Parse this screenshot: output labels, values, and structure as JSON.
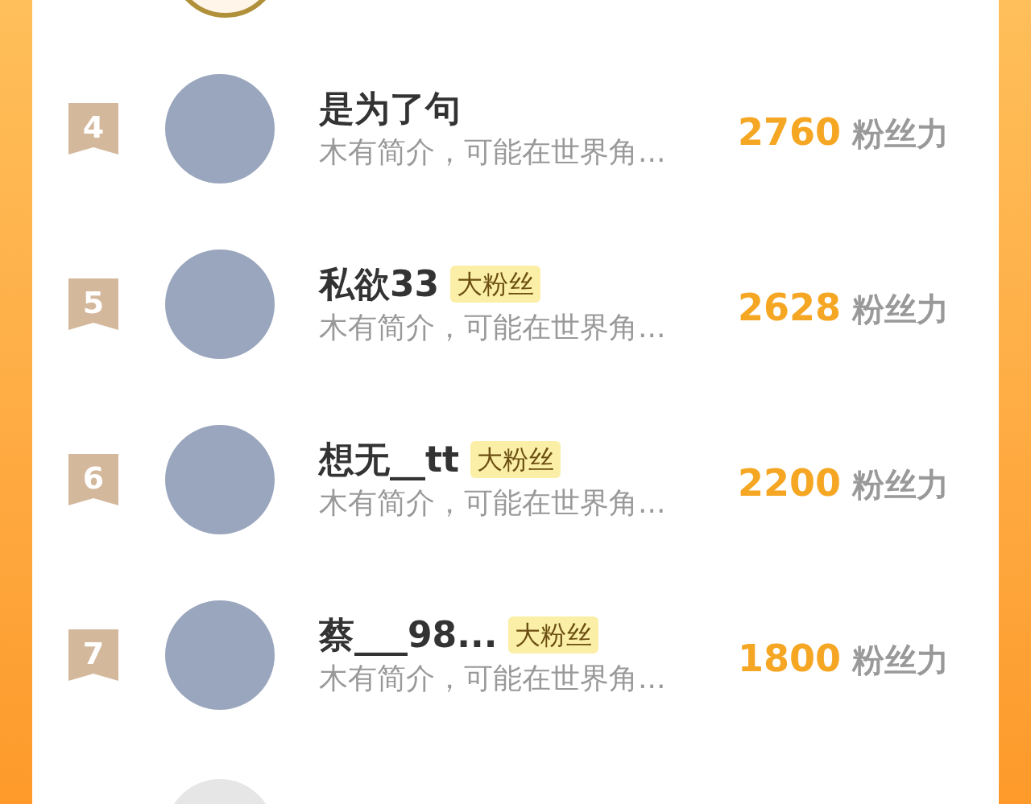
{
  "rows": [
    {
      "rank": "4",
      "name": "是为了句",
      "intro": "木有简介，可能在世界角...",
      "score": "2760",
      "score_unit": "粉丝力"
    },
    {
      "rank": "5",
      "name": "私欲33",
      "badge": "大粉丝",
      "intro": "木有简介，可能在世界角...",
      "score": "2628",
      "score_unit": "粉丝力"
    },
    {
      "rank": "6",
      "name": "想无__tt",
      "badge": "大粉丝",
      "intro": "木有简介，可能在世界角...",
      "score": "2200",
      "score_unit": "粉丝力"
    },
    {
      "rank": "7",
      "name": "蔡___98...",
      "badge": "大粉丝",
      "intro": "木有简介，可能在世界角...",
      "score": "1800",
      "score_unit": "粉丝力"
    }
  ]
}
